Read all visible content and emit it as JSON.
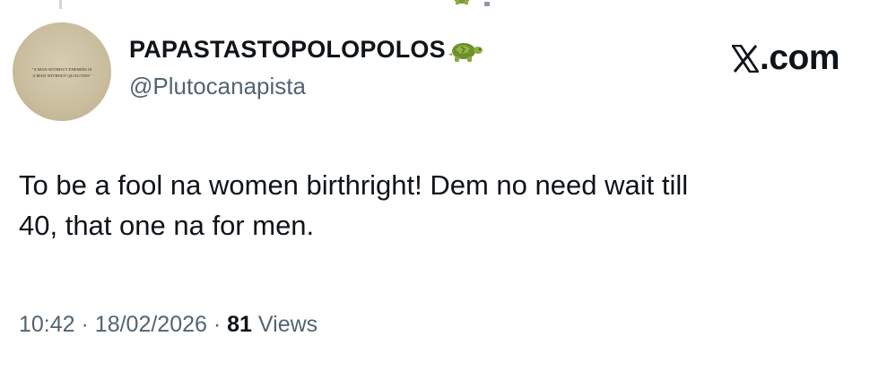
{
  "post": {
    "display_name": "PAPASTASTOPOLOPOLOS",
    "badge_icon": "turtle-icon",
    "handle": "@Plutocanapista",
    "avatar_caption_line1": "\"A MAN WITHOUT ENEMIES IS",
    "avatar_caption_line2": "A MAN WITHOUT QUALITIES\"",
    "text_line1": "To be a fool na women birthright! Dem no need wait till",
    "text_line2": "40, that one na for men.",
    "time": "10:42",
    "separator": "·",
    "date": "18/02/2026",
    "views_count": "81",
    "views_label": "Views"
  },
  "watermark": {
    "logo_icon": "x-logo-icon",
    "text": ".com"
  },
  "colors": {
    "primary_text": "#0f1419",
    "secondary_text": "#536471",
    "background": "#ffffff"
  }
}
